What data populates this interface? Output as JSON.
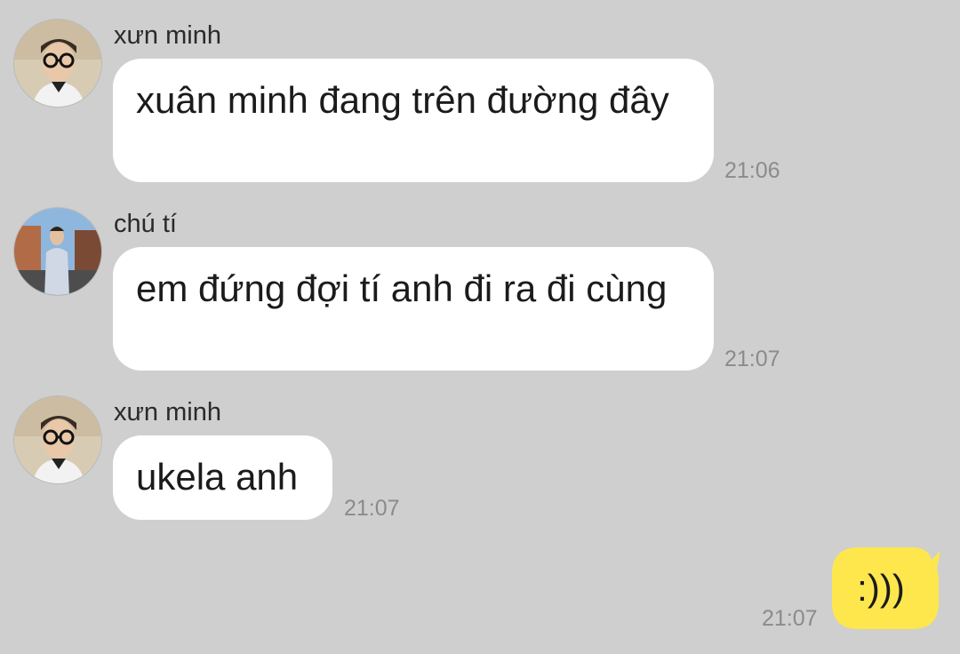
{
  "messages": [
    {
      "sender": "xưn minh",
      "text": "xuân minh đang trên đường đây",
      "time": "21:06"
    },
    {
      "sender": "chú tí",
      "text": "em đứng đợi tí anh đi ra đi cùng",
      "time": "21:07"
    },
    {
      "sender": "xưn minh",
      "text": "ukela anh",
      "time": "21:07"
    }
  ],
  "my_message": {
    "text": ":)))",
    "time": "21:07"
  },
  "colors": {
    "background": "#cfcfcf",
    "incoming_bubble": "#ffffff",
    "outgoing_bubble": "#fde74c",
    "time": "#8b8b8b"
  }
}
